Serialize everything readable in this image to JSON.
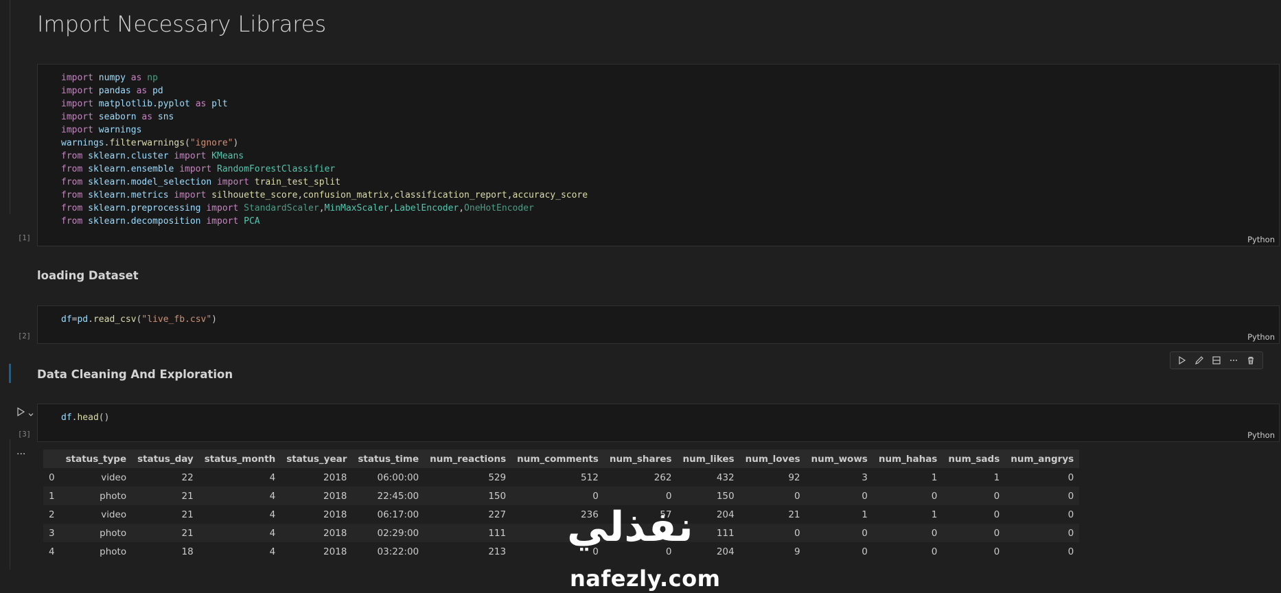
{
  "headings": {
    "import": "Import Necessary Librares",
    "loading": "loading Dataset",
    "cleaning": "Data Cleaning And Exploration"
  },
  "cells": {
    "cell1": {
      "exec_count": "[1]",
      "language": "Python"
    },
    "cell2": {
      "exec_count": "[2]",
      "language": "Python"
    },
    "cell3": {
      "exec_count": "[3]",
      "language": "Python"
    }
  },
  "code": {
    "l1": [
      "import",
      "numpy",
      "as",
      "np"
    ],
    "l2": [
      "import",
      "pandas",
      "as",
      "pd"
    ],
    "l3": [
      "import",
      "matplotlib.pyplot",
      "as",
      "plt"
    ],
    "l4": [
      "import",
      "seaborn",
      "as",
      "sns"
    ],
    "l5": [
      "import",
      "warnings"
    ],
    "l6": [
      "warnings",
      ".",
      "filterwarnings",
      "(",
      "\"ignore\"",
      ")"
    ],
    "l7": [
      "from",
      "sklearn.cluster",
      "import",
      "KMeans"
    ],
    "l8": [
      "from",
      "sklearn.ensemble",
      "import",
      "RandomForestClassifier"
    ],
    "l9": [
      "from",
      "sklearn.model_selection",
      "import",
      "train_test_split"
    ],
    "l10": [
      "from",
      "sklearn.metrics",
      "import",
      "silhouette_score",
      ",",
      "confusion_matrix",
      ",",
      "classification_report",
      ",",
      "accuracy_score"
    ],
    "l11": [
      "from",
      "sklearn.preprocessing",
      "import",
      "StandardScaler",
      ",",
      "MinMaxScaler",
      ",",
      "LabelEncoder",
      ",",
      "OneHotEncoder"
    ],
    "l12": [
      "from",
      "sklearn.decomposition",
      "import",
      "PCA"
    ],
    "c2": [
      "df",
      "=",
      "pd",
      ".",
      "read_csv",
      "(",
      "\"live_fb.csv\"",
      ")"
    ],
    "c3": [
      "df",
      ".",
      "head",
      "()"
    ]
  },
  "output_more": "...",
  "table": {
    "columns": [
      "status_type",
      "status_day",
      "status_month",
      "status_year",
      "status_time",
      "num_reactions",
      "num_comments",
      "num_shares",
      "num_likes",
      "num_loves",
      "num_wows",
      "num_hahas",
      "num_sads",
      "num_angrys"
    ],
    "rows": [
      [
        "0",
        "video",
        "22",
        "4",
        "2018",
        "06:00:00",
        "529",
        "512",
        "262",
        "432",
        "92",
        "3",
        "1",
        "1",
        "0"
      ],
      [
        "1",
        "photo",
        "21",
        "4",
        "2018",
        "22:45:00",
        "150",
        "0",
        "0",
        "150",
        "0",
        "0",
        "0",
        "0",
        "0"
      ],
      [
        "2",
        "video",
        "21",
        "4",
        "2018",
        "06:17:00",
        "227",
        "236",
        "57",
        "204",
        "21",
        "1",
        "1",
        "0",
        "0"
      ],
      [
        "3",
        "photo",
        "21",
        "4",
        "2018",
        "02:29:00",
        "111",
        "0",
        "0",
        "111",
        "0",
        "0",
        "0",
        "0",
        "0"
      ],
      [
        "4",
        "photo",
        "18",
        "4",
        "2018",
        "03:22:00",
        "213",
        "0",
        "0",
        "204",
        "9",
        "0",
        "0",
        "0",
        "0"
      ]
    ]
  },
  "watermark": {
    "arabic": "نفذلي",
    "latin": "nafezly.com"
  },
  "icons": {
    "run": "play-icon",
    "edit": "pencil-icon",
    "split": "split-cell-icon",
    "more": "more-icon",
    "delete": "trash-icon",
    "expand": "chevron-down-icon"
  }
}
